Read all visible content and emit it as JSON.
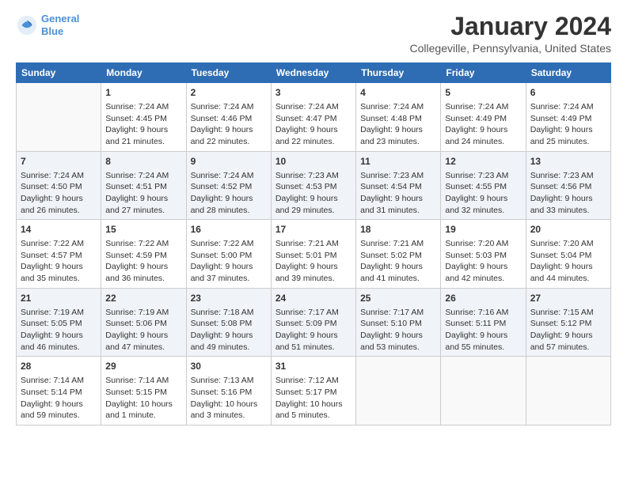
{
  "header": {
    "logo_line1": "General",
    "logo_line2": "Blue",
    "title": "January 2024",
    "subtitle": "Collegeville, Pennsylvania, United States"
  },
  "days_of_week": [
    "Sunday",
    "Monday",
    "Tuesday",
    "Wednesday",
    "Thursday",
    "Friday",
    "Saturday"
  ],
  "weeks": [
    [
      {
        "day": "",
        "content": ""
      },
      {
        "day": "1",
        "content": "Sunrise: 7:24 AM\nSunset: 4:45 PM\nDaylight: 9 hours\nand 21 minutes."
      },
      {
        "day": "2",
        "content": "Sunrise: 7:24 AM\nSunset: 4:46 PM\nDaylight: 9 hours\nand 22 minutes."
      },
      {
        "day": "3",
        "content": "Sunrise: 7:24 AM\nSunset: 4:47 PM\nDaylight: 9 hours\nand 22 minutes."
      },
      {
        "day": "4",
        "content": "Sunrise: 7:24 AM\nSunset: 4:48 PM\nDaylight: 9 hours\nand 23 minutes."
      },
      {
        "day": "5",
        "content": "Sunrise: 7:24 AM\nSunset: 4:49 PM\nDaylight: 9 hours\nand 24 minutes."
      },
      {
        "day": "6",
        "content": "Sunrise: 7:24 AM\nSunset: 4:49 PM\nDaylight: 9 hours\nand 25 minutes."
      }
    ],
    [
      {
        "day": "7",
        "content": "Sunrise: 7:24 AM\nSunset: 4:50 PM\nDaylight: 9 hours\nand 26 minutes."
      },
      {
        "day": "8",
        "content": "Sunrise: 7:24 AM\nSunset: 4:51 PM\nDaylight: 9 hours\nand 27 minutes."
      },
      {
        "day": "9",
        "content": "Sunrise: 7:24 AM\nSunset: 4:52 PM\nDaylight: 9 hours\nand 28 minutes."
      },
      {
        "day": "10",
        "content": "Sunrise: 7:23 AM\nSunset: 4:53 PM\nDaylight: 9 hours\nand 29 minutes."
      },
      {
        "day": "11",
        "content": "Sunrise: 7:23 AM\nSunset: 4:54 PM\nDaylight: 9 hours\nand 31 minutes."
      },
      {
        "day": "12",
        "content": "Sunrise: 7:23 AM\nSunset: 4:55 PM\nDaylight: 9 hours\nand 32 minutes."
      },
      {
        "day": "13",
        "content": "Sunrise: 7:23 AM\nSunset: 4:56 PM\nDaylight: 9 hours\nand 33 minutes."
      }
    ],
    [
      {
        "day": "14",
        "content": "Sunrise: 7:22 AM\nSunset: 4:57 PM\nDaylight: 9 hours\nand 35 minutes."
      },
      {
        "day": "15",
        "content": "Sunrise: 7:22 AM\nSunset: 4:59 PM\nDaylight: 9 hours\nand 36 minutes."
      },
      {
        "day": "16",
        "content": "Sunrise: 7:22 AM\nSunset: 5:00 PM\nDaylight: 9 hours\nand 37 minutes."
      },
      {
        "day": "17",
        "content": "Sunrise: 7:21 AM\nSunset: 5:01 PM\nDaylight: 9 hours\nand 39 minutes."
      },
      {
        "day": "18",
        "content": "Sunrise: 7:21 AM\nSunset: 5:02 PM\nDaylight: 9 hours\nand 41 minutes."
      },
      {
        "day": "19",
        "content": "Sunrise: 7:20 AM\nSunset: 5:03 PM\nDaylight: 9 hours\nand 42 minutes."
      },
      {
        "day": "20",
        "content": "Sunrise: 7:20 AM\nSunset: 5:04 PM\nDaylight: 9 hours\nand 44 minutes."
      }
    ],
    [
      {
        "day": "21",
        "content": "Sunrise: 7:19 AM\nSunset: 5:05 PM\nDaylight: 9 hours\nand 46 minutes."
      },
      {
        "day": "22",
        "content": "Sunrise: 7:19 AM\nSunset: 5:06 PM\nDaylight: 9 hours\nand 47 minutes."
      },
      {
        "day": "23",
        "content": "Sunrise: 7:18 AM\nSunset: 5:08 PM\nDaylight: 9 hours\nand 49 minutes."
      },
      {
        "day": "24",
        "content": "Sunrise: 7:17 AM\nSunset: 5:09 PM\nDaylight: 9 hours\nand 51 minutes."
      },
      {
        "day": "25",
        "content": "Sunrise: 7:17 AM\nSunset: 5:10 PM\nDaylight: 9 hours\nand 53 minutes."
      },
      {
        "day": "26",
        "content": "Sunrise: 7:16 AM\nSunset: 5:11 PM\nDaylight: 9 hours\nand 55 minutes."
      },
      {
        "day": "27",
        "content": "Sunrise: 7:15 AM\nSunset: 5:12 PM\nDaylight: 9 hours\nand 57 minutes."
      }
    ],
    [
      {
        "day": "28",
        "content": "Sunrise: 7:14 AM\nSunset: 5:14 PM\nDaylight: 9 hours\nand 59 minutes."
      },
      {
        "day": "29",
        "content": "Sunrise: 7:14 AM\nSunset: 5:15 PM\nDaylight: 10 hours\nand 1 minute."
      },
      {
        "day": "30",
        "content": "Sunrise: 7:13 AM\nSunset: 5:16 PM\nDaylight: 10 hours\nand 3 minutes."
      },
      {
        "day": "31",
        "content": "Sunrise: 7:12 AM\nSunset: 5:17 PM\nDaylight: 10 hours\nand 5 minutes."
      },
      {
        "day": "",
        "content": ""
      },
      {
        "day": "",
        "content": ""
      },
      {
        "day": "",
        "content": ""
      }
    ]
  ]
}
